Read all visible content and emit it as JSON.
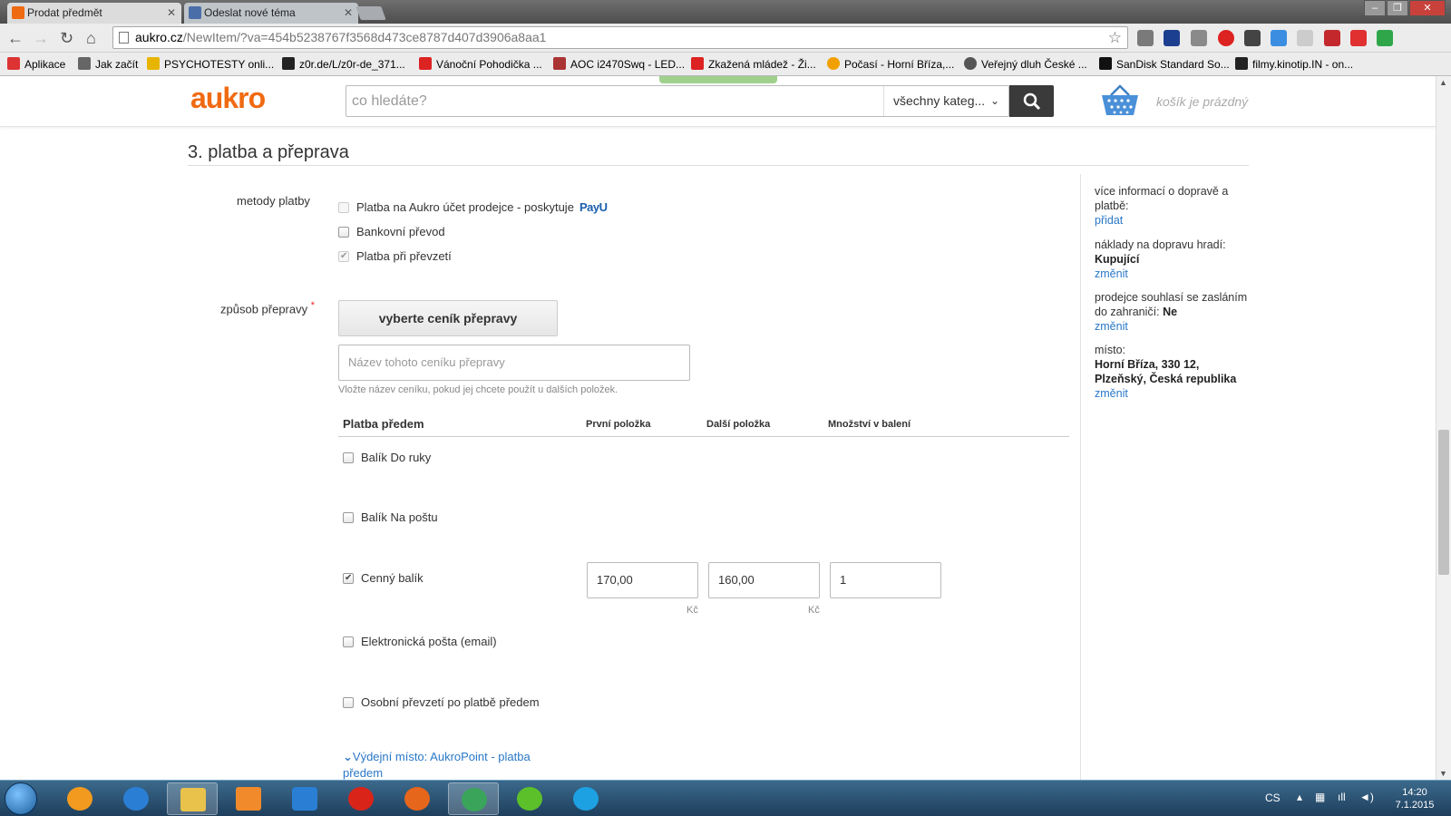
{
  "browser": {
    "tabs": [
      {
        "title": "Prodat předmět",
        "active": true,
        "favicon_color": "#f06a12"
      },
      {
        "title": "Odeslat nové téma",
        "active": false,
        "favicon_color": "#4a6ea8"
      }
    ],
    "url_host": "aukro.cz",
    "url_path": "/NewItem/?va=454b5238767f3568d473ce8787d407d3906a8aa1",
    "bookmarks": [
      {
        "label": "Aplikace",
        "icon": "apps-grid-icon",
        "color": "#d33"
      },
      {
        "label": "Jak začít",
        "icon": "page-icon",
        "color": "#666"
      },
      {
        "label": "PSYCHOTESTY onli...",
        "icon": "crown-icon",
        "color": "#e7b400"
      },
      {
        "label": "z0r.de/L/z0r-de_371...",
        "icon": "z0r-icon",
        "color": "#222"
      },
      {
        "label": "Vánoční Pohodička ...",
        "icon": "youtube-icon",
        "color": "#d22"
      },
      {
        "label": "AOC i2470Swq - LED...",
        "icon": "shop-icon",
        "color": "#a33"
      },
      {
        "label": "Zkažená mládež - Ži...",
        "icon": "youtube-icon",
        "color": "#d22"
      },
      {
        "label": "Počasí - Horní Bříza,...",
        "icon": "sun-icon",
        "color": "#f0a000"
      },
      {
        "label": "Veřejný dluh České ...",
        "icon": "globe-icon",
        "color": "#555"
      },
      {
        "label": "SanDisk Standard So...",
        "icon": "amazon-icon",
        "color": "#111"
      },
      {
        "label": "filmy.kinotip.IN - on...",
        "icon": "k-icon",
        "color": "#222"
      }
    ]
  },
  "header": {
    "logo": "aukro",
    "search_placeholder": "co hledáte?",
    "category_label": "všechny kateg...",
    "cart_label": "košík je prázdný"
  },
  "section": {
    "title": "3. platba a přeprava",
    "payment_methods_label": "metody platby",
    "payment_methods": [
      {
        "label": "Platba na Aukro účet prodejce - poskytuje",
        "checked": false,
        "disabled": true,
        "badge": "PayU"
      },
      {
        "label": "Bankovní převod",
        "checked": false,
        "disabled": false
      },
      {
        "label": "Platba při převzetí",
        "checked": true,
        "disabled": true
      }
    ],
    "shipping_label": "způsob přepravy",
    "required_mark": "*",
    "pricelist_button": "vyberte ceník přepravy",
    "pricelist_name_placeholder": "Název tohoto ceníku přepravy",
    "pricelist_hint": "Vložte název ceníku, pokud jej chcete použít u dalších položek.",
    "table_headers": {
      "group": "Platba předem",
      "first": "První položka",
      "next": "Další položka",
      "qty": "Množství v balení"
    },
    "shipping_options": [
      {
        "label": "Balík Do ruky",
        "checked": false
      },
      {
        "label": "Balík Na poštu",
        "checked": false
      },
      {
        "label": "Cenný balík",
        "checked": true,
        "first": "170,00",
        "next": "160,00",
        "qty": "1",
        "unit": "Kč"
      },
      {
        "label": "Elektronická pošta (email)",
        "checked": false
      },
      {
        "label": "Osobní převzetí po platbě předem",
        "checked": false
      }
    ],
    "aukropoint_link": "Výdejní místo: AukroPoint - platba předem"
  },
  "sidebar": {
    "shipping_info_text": "více informací o dopravě a platbě:",
    "shipping_info_link": "přidat",
    "shipping_cost_text": "náklady na dopravu hradí:",
    "shipping_cost_value": "Kupující",
    "shipping_cost_link": "změnit",
    "abroad_text": "prodejce souhlasí se zasláním do zahraničí:",
    "abroad_value": "Ne",
    "abroad_link": "změnit",
    "location_text": "místo:",
    "location_value": "Horní Bříza, 330 12, Plzeňský, Česká republika",
    "location_link": "změnit"
  },
  "taskbar": {
    "apps": [
      {
        "icon": "xampp-icon",
        "color": "#f29a1f"
      },
      {
        "icon": "internet-explorer-icon",
        "color": "#2a7fd4"
      },
      {
        "icon": "file-explorer-icon",
        "color": "#e8c24a"
      },
      {
        "icon": "media-player-icon",
        "color": "#f08a2a"
      },
      {
        "icon": "store-icon",
        "color": "#2a7fd4"
      },
      {
        "icon": "opera-icon",
        "color": "#d9241a"
      },
      {
        "icon": "firefox-icon",
        "color": "#e6661c"
      },
      {
        "icon": "chrome-icon",
        "color": "#3aa55a"
      },
      {
        "icon": "icq-icon",
        "color": "#5cc02a"
      },
      {
        "icon": "skype-icon",
        "color": "#1da1e2"
      }
    ],
    "language": "CS",
    "time": "14:20",
    "date": "7.1.2015"
  }
}
